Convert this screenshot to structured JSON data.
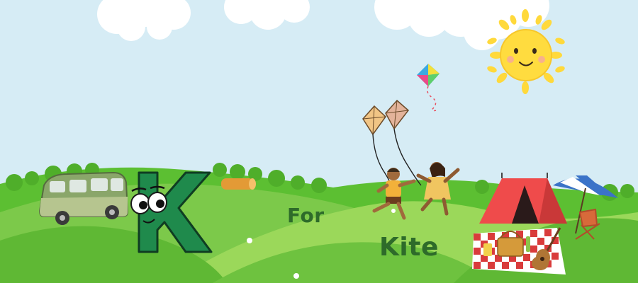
{
  "scene": {
    "letter": "K",
    "word_for": "For",
    "word_kite": "Kite"
  },
  "colors": {
    "sky": "#d6ecf5",
    "grass_light": "#8fd14f",
    "grass_dark": "#4caf2e",
    "letter": "#1f8a4c",
    "text": "#2e6b2a",
    "sun": "#ffd93b",
    "tent": "#ef4b4b"
  },
  "icons": [
    "cloud-icon",
    "sun-icon",
    "van-icon",
    "letter-k-character",
    "log-icon",
    "kite-icon",
    "children-flying-kites",
    "tent-icon",
    "umbrella-icon",
    "picnic-blanket-icon",
    "guitar-icon",
    "chair-icon",
    "flower-icon"
  ]
}
